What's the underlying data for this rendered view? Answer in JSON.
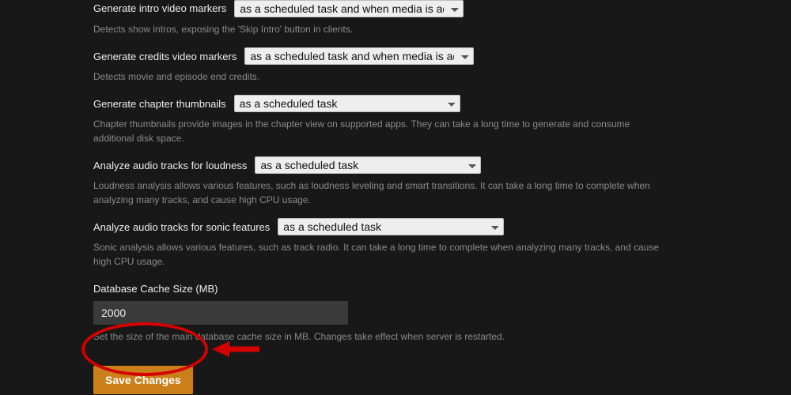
{
  "settings": {
    "intro": {
      "label": "Generate intro video markers",
      "value": "as a scheduled task and when media is added",
      "help": "Detects show intros, exposing the 'Skip Intro' button in clients."
    },
    "credits": {
      "label": "Generate credits video markers",
      "value": "as a scheduled task and when media is added",
      "help": "Detects movie and episode end credits."
    },
    "chapter": {
      "label": "Generate chapter thumbnails",
      "value": "as a scheduled task",
      "help": "Chapter thumbnails provide images in the chapter view on supported apps. They can take a long time to generate and consume additional disk space."
    },
    "loudness": {
      "label": "Analyze audio tracks for loudness",
      "value": "as a scheduled task",
      "help": "Loudness analysis allows various features, such as loudness leveling and smart transitions. It can take a long time to complete when analyzing many tracks, and cause high CPU usage."
    },
    "sonic": {
      "label": "Analyze audio tracks for sonic features",
      "value": "as a scheduled task",
      "help": "Sonic analysis allows various features, such as track radio. It can take a long time to complete when analyzing many tracks, and cause high CPU usage."
    },
    "cache": {
      "label": "Database Cache Size (MB)",
      "value": "2000",
      "help": "Set the size of the main database cache size in MB. Changes take effect when server is restarted."
    }
  },
  "buttons": {
    "save": "Save Changes"
  }
}
